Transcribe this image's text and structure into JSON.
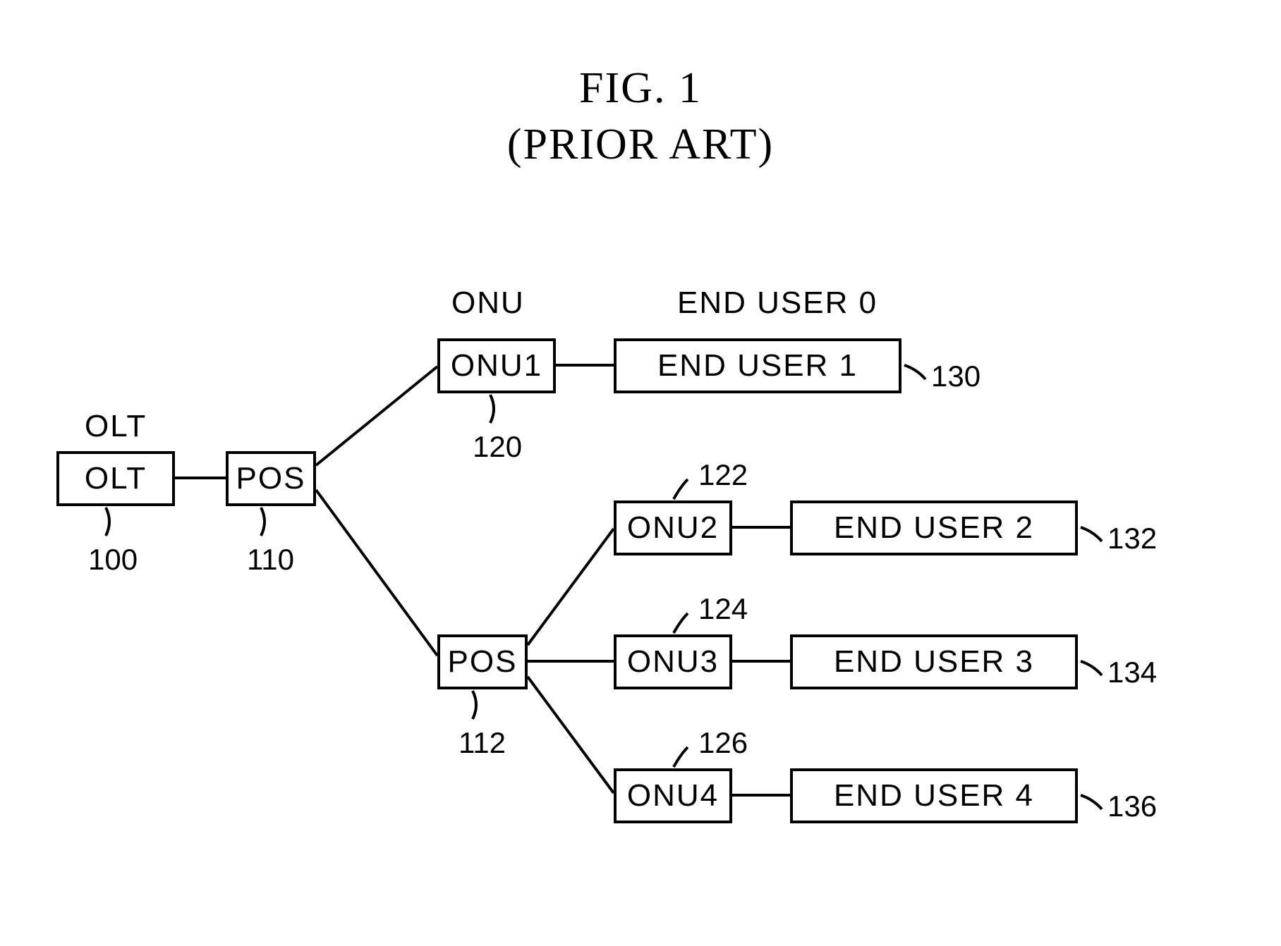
{
  "title": {
    "line1": "FIG.  1",
    "line2": "(PRIOR  ART)"
  },
  "headers": {
    "olt": "OLT",
    "onu": "ONU",
    "end_user_0": "END USER 0"
  },
  "nodes": {
    "olt": {
      "label": "OLT",
      "ref": "100"
    },
    "pos1": {
      "label": "POS",
      "ref": "110"
    },
    "pos2": {
      "label": "POS",
      "ref": "112"
    },
    "onu1": {
      "label": "ONU1",
      "ref": "120"
    },
    "onu2": {
      "label": "ONU2",
      "ref": "122"
    },
    "onu3": {
      "label": "ONU3",
      "ref": "124"
    },
    "onu4": {
      "label": "ONU4",
      "ref": "126"
    },
    "eu1": {
      "label": "END USER 1",
      "ref": "130"
    },
    "eu2": {
      "label": "END USER 2",
      "ref": "132"
    },
    "eu3": {
      "label": "END USER 3",
      "ref": "134"
    },
    "eu4": {
      "label": "END USER 4",
      "ref": "136"
    }
  }
}
